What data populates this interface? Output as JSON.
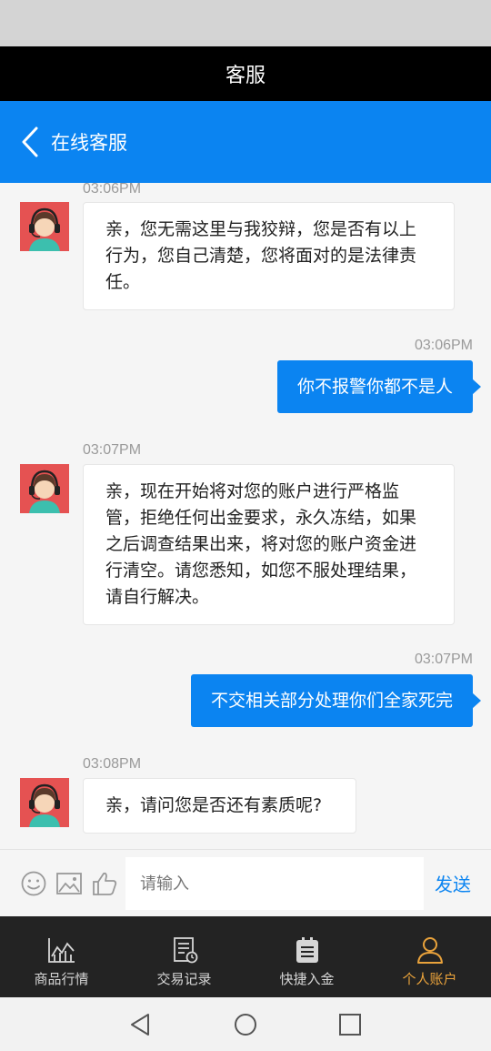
{
  "title_bar": {
    "title": "客服"
  },
  "nav": {
    "title": "在线客服"
  },
  "chat": {
    "messages": [
      {
        "time": "03:06PM",
        "text": "亲，您无需这里与我狡辩，您是否有以上行为，您自己清楚，您将面对的是法律责任。",
        "lines": [
          "亲，您无需这里与我狡辩，您是否有以上",
          "行为，您自己清楚，您将面对的是法律责",
          "任。"
        ]
      },
      {
        "time": "03:06PM",
        "text": "你不报警你都不是人"
      },
      {
        "time": "03:07PM",
        "text": "亲，现在开始将对您的账户进行严格监管，拒绝任何出金要求，永久冻结，如果之后调查结果出来，将对您的账户资金进行清空。请您悉知，如您不服处理结果，请自行解决。",
        "lines": [
          "亲，现在开始将对您的账户进行严格监",
          "管，拒绝任何出金要求，永久冻结，如果",
          "之后调查结果出来，将对您的账户资金进",
          "行清空。请您悉知，如您不服处理结果，",
          "请自行解决。"
        ]
      },
      {
        "time": "03:07PM",
        "text": "不交相关部分处理你们全家死完"
      },
      {
        "time": "03:08PM",
        "text": "亲，请问您是否还有素质呢?"
      }
    ]
  },
  "input": {
    "placeholder": "请输入",
    "send_label": "发送"
  },
  "tabs": [
    {
      "label": "商品行情",
      "icon": "chart-icon"
    },
    {
      "label": "交易记录",
      "icon": "record-icon"
    },
    {
      "label": "快捷入金",
      "icon": "clipboard-icon"
    },
    {
      "label": "个人账户",
      "icon": "user-icon",
      "active": true
    }
  ],
  "colors": {
    "accent": "#0b84f1",
    "tab_active": "#e9a23b",
    "tabbar_bg": "#232323"
  }
}
